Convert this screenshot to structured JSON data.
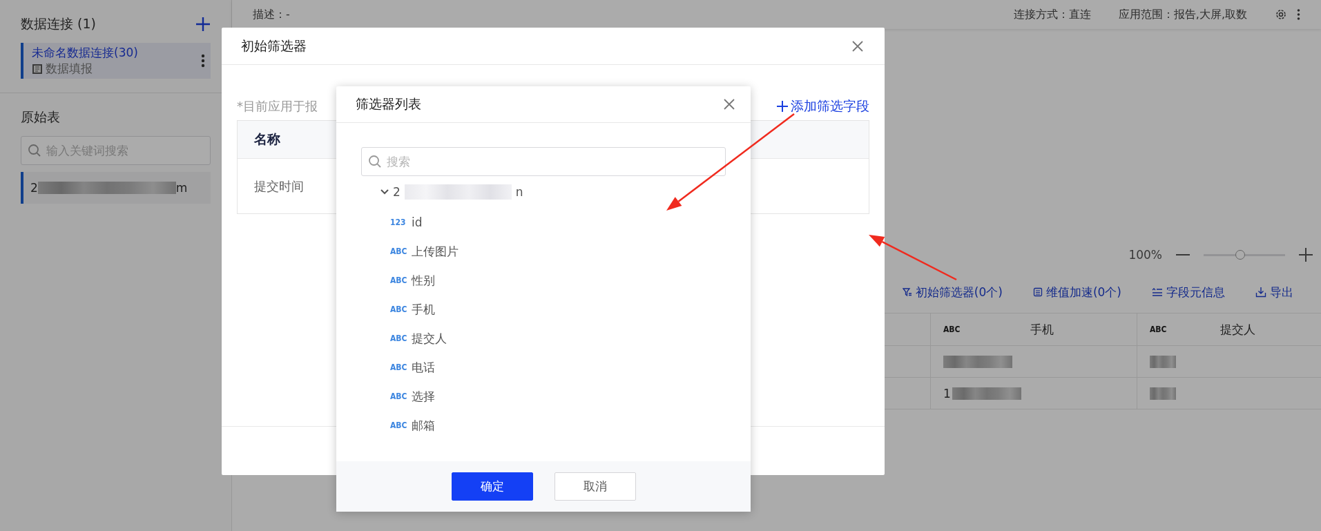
{
  "sidebar": {
    "connections_title": "数据连接 (1)",
    "connections": [
      {
        "name": "未命名数据连接(30)",
        "type": "数据填报",
        "selected": true
      }
    ],
    "tables_title": "原始表",
    "search": {
      "placeholder": "输入关键词搜索"
    },
    "tables": [
      {
        "prefix": "2",
        "suffix": "m",
        "selected": true
      }
    ]
  },
  "header": {
    "description": "描述：-",
    "connection_mode": "连接方式：直连",
    "scope": "应用范围：报告,大屏,取数"
  },
  "zoom": {
    "reading": "100%",
    "level": 0.45
  },
  "toolbar": [
    {
      "label": "初始筛选器(0个)",
      "kind": "filter"
    },
    {
      "label": "维值加速(0个)",
      "kind": "index"
    },
    {
      "label": "字段元信息",
      "kind": "meta"
    },
    {
      "label": "导出",
      "kind": "export"
    }
  ],
  "table": {
    "columns": [
      {
        "type": "ABC",
        "name": "手机"
      },
      {
        "type": "ABC",
        "name": "提交人"
      }
    ],
    "rows": [
      {
        "cells": [
          {
            "redacted": true
          },
          {
            "redacted": true
          }
        ]
      },
      {
        "cells": [
          {
            "redacted": true,
            "text": "1"
          },
          {
            "redacted": true
          }
        ]
      }
    ]
  },
  "filter_dialog": {
    "title": "初始筛选器",
    "note": "*目前应用于报",
    "add_button": "添加筛选字段",
    "table": {
      "column": "名称",
      "rows": [
        "提交时间"
      ]
    }
  },
  "filter_list_dialog": {
    "title": "筛选器列表",
    "search": {
      "placeholder": "搜索"
    },
    "tree": {
      "prefix": "2",
      "suffix": "n",
      "expanded": true,
      "children": [
        {
          "type": "123",
          "name": "id"
        },
        {
          "type": "ABC",
          "name": "上传图片"
        },
        {
          "type": "ABC",
          "name": "性别"
        },
        {
          "type": "ABC",
          "name": "手机"
        },
        {
          "type": "ABC",
          "name": "提交人"
        },
        {
          "type": "ABC",
          "name": "电话"
        },
        {
          "type": "ABC",
          "name": "选择"
        },
        {
          "type": "ABC",
          "name": "邮箱"
        }
      ]
    },
    "buttons": [
      {
        "label": "确定",
        "kind": "primary"
      },
      {
        "label": "取消",
        "kind": "secondary"
      }
    ]
  }
}
